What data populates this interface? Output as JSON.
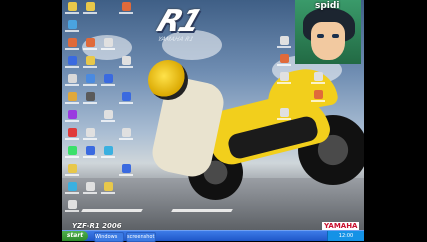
{
  "wallpaper": {
    "logo_text": "R1",
    "logo_subtext": "YAMAHA R1",
    "model_text": "YZF-R1 2006",
    "brand_text": "YAMAHA"
  },
  "avatar": {
    "label": "spidi"
  },
  "taskbar": {
    "start_label": "start",
    "buttons": [
      {
        "label": "Windows"
      },
      {
        "label": "screenshot"
      }
    ],
    "clock": "12:00"
  },
  "colors": {
    "taskbar": "#245edc",
    "start": "#3c9a38",
    "bike_yellow": "#f2cf1c",
    "brand_red": "#c8102e"
  }
}
